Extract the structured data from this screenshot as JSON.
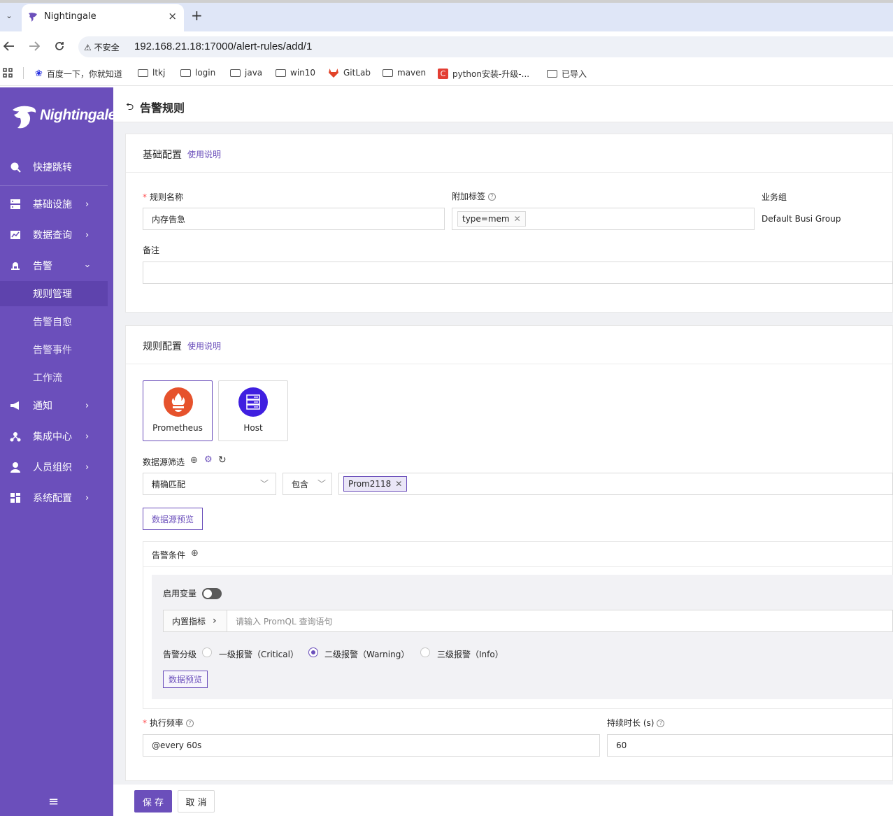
{
  "browser": {
    "tab_title": "Nightingale",
    "tab_close": "×",
    "new_tab": "+",
    "security_label": "不安全",
    "url": "192.168.21.18:17000/alert-rules/add/1",
    "bookmarks": [
      "百度一下，你就知道",
      "ltkj",
      "login",
      "java",
      "win10",
      "GitLab",
      "maven",
      "python安装-升级-...",
      "已导入"
    ]
  },
  "sidebar": {
    "logo": "Nightingale",
    "quick_jump": "快捷跳转",
    "items": [
      {
        "label": "基础设施",
        "icon": "server-icon"
      },
      {
        "label": "数据查询",
        "icon": "chart-icon"
      },
      {
        "label": "告警",
        "icon": "bell-icon"
      }
    ],
    "alert_sub": [
      "规则管理",
      "告警自愈",
      "告警事件",
      "工作流"
    ],
    "items2": [
      {
        "label": "通知",
        "icon": "megaphone-icon"
      },
      {
        "label": "集成中心",
        "icon": "integration-icon"
      },
      {
        "label": "人员组织",
        "icon": "user-icon"
      },
      {
        "label": "系统配置",
        "icon": "grid-icon"
      }
    ],
    "collapse": "≡"
  },
  "page": {
    "title": "告警规则"
  },
  "basic": {
    "title": "基础配置",
    "help": "使用说明",
    "name_label": "规则名称",
    "name_value": "内存告急",
    "tags_label": "附加标签",
    "tag_value": "type=mem",
    "group_label": "业务组",
    "group_value": "Default Busi Group",
    "note_label": "备注",
    "note_value": ""
  },
  "rule": {
    "title": "规则配置",
    "help": "使用说明",
    "datasources": [
      "Prometheus",
      "Host"
    ],
    "filter_label": "数据源筛选",
    "match_mode": "精确匹配",
    "op": "包含",
    "ds_tag": "Prom2118",
    "preview_ds": "数据源预览",
    "cond_label": "告警条件",
    "enable_var": "启用变量",
    "builtin_metric": "内置指标",
    "query_placeholder": "请输入 PromQL 查询语句",
    "severity_label": "告警分级",
    "severities": [
      "一级报警（Critical）",
      "二级报警（Warning）",
      "三级报警（Info）"
    ],
    "selected_severity_index": 1,
    "preview_data": "数据预览",
    "freq_label": "执行频率",
    "freq_value": "@every 60s",
    "duration_label": "持续时长 (s)",
    "duration_value": "60"
  },
  "footer": {
    "save": "保 存",
    "cancel": "取 消"
  },
  "colors": {
    "brand": "#6b4fbb",
    "prometheus": "#e6522c",
    "host": "#3f1fe0"
  }
}
